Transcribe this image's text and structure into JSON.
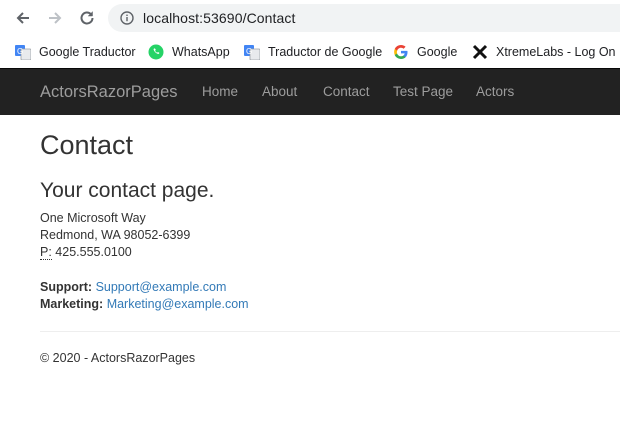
{
  "browser": {
    "url": "localhost:53690/Contact",
    "bookmarks": [
      {
        "label": "Google Traductor",
        "icon": "google-translate-icon"
      },
      {
        "label": "WhatsApp",
        "icon": "whatsapp-icon"
      },
      {
        "label": "Traductor de Google",
        "icon": "google-translate-icon"
      },
      {
        "label": "Google",
        "icon": "google-icon"
      },
      {
        "label": "XtremeLabs - Log On",
        "icon": "xtremelabs-icon"
      }
    ]
  },
  "navbar": {
    "brand": "ActorsRazorPages",
    "links": [
      "Home",
      "About",
      "Contact",
      "Test Page",
      "Actors"
    ]
  },
  "page": {
    "title": "Contact",
    "subtitle": "Your contact page.",
    "address_line1": "One Microsoft Way",
    "address_line2": "Redmond, WA 98052-6399",
    "phone_label": "P:",
    "phone": "425.555.0100",
    "support_label": "Support:",
    "support_email": "Support@example.com",
    "marketing_label": "Marketing:",
    "marketing_email": "Marketing@example.com"
  },
  "footer": {
    "text": "© 2020 - ActorsRazorPages"
  },
  "colors": {
    "navbar_bg": "#222222",
    "nav_text": "#9d9d9d",
    "link": "#337ab7"
  }
}
